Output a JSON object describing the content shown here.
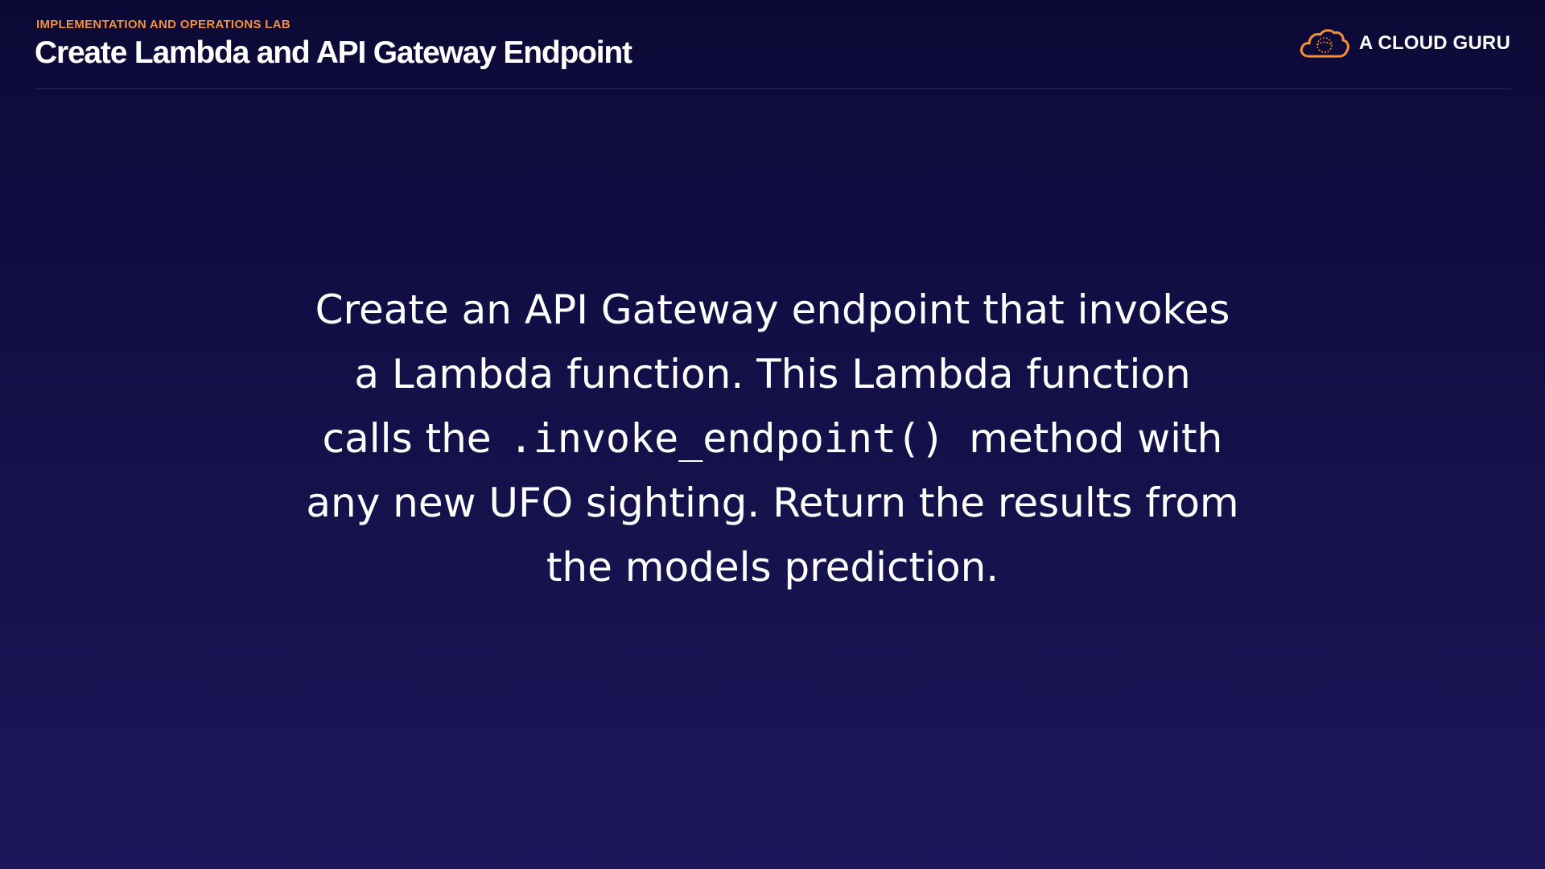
{
  "header": {
    "eyebrow": "IMPLEMENTATION AND OPERATIONS LAB",
    "title": "Create Lambda and API Gateway Endpoint",
    "brand": {
      "logo_icon": "cloud-icon",
      "name": "A CLOUD GURU",
      "accent_color": "#f1913a"
    }
  },
  "body": {
    "line1": "Create an API Gateway endpoint that invokes",
    "line2": "a Lambda function. This Lambda function",
    "line3_prefix": "calls the",
    "line3_code": ".invoke_endpoint()",
    "line3_suffix": "method with",
    "line4": "any new UFO sighting. Return the results from",
    "line5": "the models prediction."
  }
}
